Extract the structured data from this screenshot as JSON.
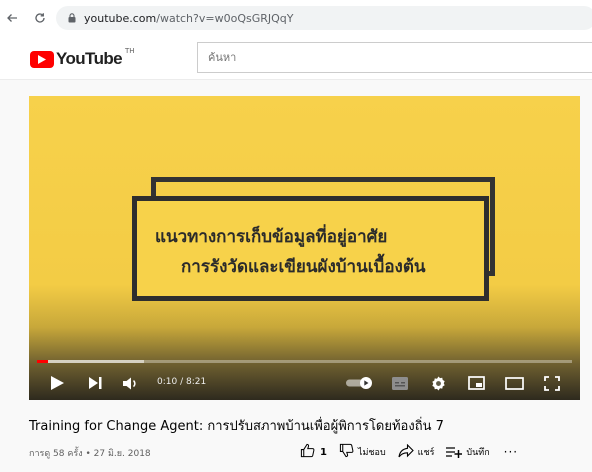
{
  "browser": {
    "url_domain": "youtube.com",
    "url_path": "/watch?v=w0oQsGRJQqY"
  },
  "header": {
    "logo_text": "YouTube",
    "region": "TH",
    "search_placeholder": "ค้นหา"
  },
  "player": {
    "slide_line1": "แนวทางการเก็บข้อมูลที่อยู่อาศัย",
    "slide_line2": "การรังวัดและเขียนผังบ้านเบื้องต้น",
    "current_time": "0:10",
    "duration": "8:21",
    "played_fraction": 0.02,
    "buffered_fraction": 0.2,
    "accent_color": "#ff0000"
  },
  "video": {
    "title": "Training for Change Agent: การปรับสภาพบ้านเพื่อผู้พิการโดยท้องถิ่น 7",
    "meta": "การดู 58 ครั้ง • 27 มิ.ย. 2018",
    "like_count": "1",
    "dislike_label": "ไม่ชอบ",
    "share_label": "แชร์",
    "save_label": "บันทึก",
    "more_label": "···"
  },
  "icons": [
    "back-icon",
    "reload-icon",
    "lock-icon",
    "youtube-logo-icon",
    "play-icon",
    "next-icon",
    "volume-icon",
    "autoplay-toggle-icon",
    "subtitles-icon",
    "settings-icon",
    "miniplayer-icon",
    "theater-icon",
    "fullscreen-icon",
    "like-icon",
    "dislike-icon",
    "share-icon",
    "save-icon"
  ]
}
